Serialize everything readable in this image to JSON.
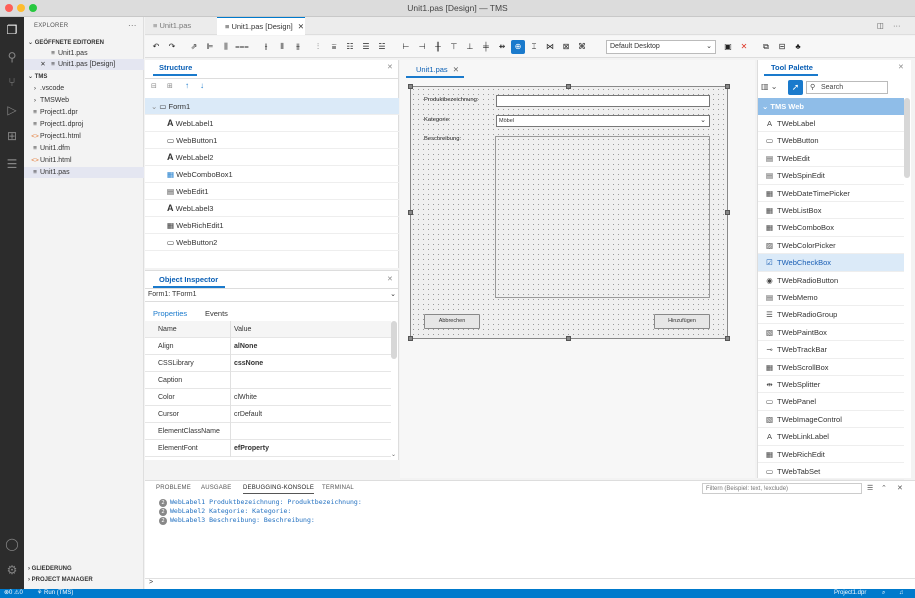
{
  "window": {
    "title": "Unit1.pas [Design] — TMS"
  },
  "explorer": {
    "header": "EXPLORER",
    "open_editors_label": "GEÖFFNETE EDITOREN",
    "open_editors": [
      {
        "name": "Unit1.pas"
      },
      {
        "name": "Unit1.pas [Design]"
      }
    ],
    "project_label": "TMS",
    "files": [
      {
        "name": ".vscode",
        "type": "folder"
      },
      {
        "name": "TMSWeb",
        "type": "folder"
      },
      {
        "name": "Project1.dpr",
        "type": "file"
      },
      {
        "name": "Project1.dproj",
        "type": "file"
      },
      {
        "name": "Project1.html",
        "type": "html"
      },
      {
        "name": "Unit1.dfm",
        "type": "file"
      },
      {
        "name": "Unit1.html",
        "type": "html"
      },
      {
        "name": "Unit1.pas",
        "type": "file"
      }
    ],
    "outline_label": "GLIEDERUNG",
    "project_manager_label": "PROJECT MANAGER"
  },
  "editor_tabs": [
    {
      "label": "Unit1.pas"
    },
    {
      "label": "Unit1.pas [Design]"
    }
  ],
  "toolbar": {
    "platform": "Default Desktop"
  },
  "structure": {
    "title": "Structure",
    "items": [
      {
        "label": "Form1",
        "icon": "form-icon"
      },
      {
        "label": "WebLabel1",
        "icon": "label-icon"
      },
      {
        "label": "WebButton1",
        "icon": "button-icon"
      },
      {
        "label": "WebLabel2",
        "icon": "label-icon"
      },
      {
        "label": "WebComboBox1",
        "icon": "combobox-icon"
      },
      {
        "label": "WebEdit1",
        "icon": "edit-icon"
      },
      {
        "label": "WebLabel3",
        "icon": "label-icon"
      },
      {
        "label": "WebRichEdit1",
        "icon": "richedit-icon"
      },
      {
        "label": "WebButton2",
        "icon": "button-icon"
      }
    ]
  },
  "inspector": {
    "title": "Object Inspector",
    "selected": "Form1: TForm1",
    "tabs": [
      "Properties",
      "Events"
    ],
    "col_name": "Name",
    "col_value": "Value",
    "rows": [
      {
        "name": "Align",
        "value": "alNone",
        "bold": true
      },
      {
        "name": "CSSLibrary",
        "value": "cssNone",
        "bold": true
      },
      {
        "name": "Caption",
        "value": "",
        "bold": false
      },
      {
        "name": "Color",
        "value": "clWhite",
        "bold": false
      },
      {
        "name": "Cursor",
        "value": "crDefault",
        "bold": false
      },
      {
        "name": "ElementClassName",
        "value": "",
        "bold": false
      },
      {
        "name": "ElementFont",
        "value": "efProperty",
        "bold": true
      }
    ]
  },
  "designer": {
    "tab": "Unit1.pas",
    "form": {
      "label1": "Produktbezeichnung:",
      "label2": "Kategorie:",
      "label3": "Beschreibung:",
      "combo_value": "Möbel",
      "button_cancel": "Abbrechen",
      "button_add": "Hinzufügen"
    }
  },
  "palette": {
    "title": "Tool Palette",
    "search_placeholder": "Search",
    "category": "TMS Web",
    "items": [
      {
        "label": "TWebLabel",
        "icon": "A"
      },
      {
        "label": "TWebButton",
        "icon": "▭"
      },
      {
        "label": "TWebEdit",
        "icon": "▤"
      },
      {
        "label": "TWebSpinEdit",
        "icon": "▤"
      },
      {
        "label": "TWebDateTimePicker",
        "icon": "▦"
      },
      {
        "label": "TWebListBox",
        "icon": "▦"
      },
      {
        "label": "TWebComboBox",
        "icon": "▦"
      },
      {
        "label": "TWebColorPicker",
        "icon": "▨"
      },
      {
        "label": "TWebCheckBox",
        "icon": "☑"
      },
      {
        "label": "TWebRadioButton",
        "icon": "◉"
      },
      {
        "label": "TWebMemo",
        "icon": "▤"
      },
      {
        "label": "TWebRadioGroup",
        "icon": "☰"
      },
      {
        "label": "TWebPaintBox",
        "icon": "▧"
      },
      {
        "label": "TWebTrackBar",
        "icon": "⊸"
      },
      {
        "label": "TWebScrollBox",
        "icon": "▦"
      },
      {
        "label": "TWebSplitter",
        "icon": "⇹"
      },
      {
        "label": "TWebPanel",
        "icon": "▭"
      },
      {
        "label": "TWebImageControl",
        "icon": "▧"
      },
      {
        "label": "TWebLinkLabel",
        "icon": "A"
      },
      {
        "label": "TWebRichEdit",
        "icon": "▦"
      },
      {
        "label": "TWebTabSet",
        "icon": "▭"
      }
    ]
  },
  "bottom_panel": {
    "tabs": [
      "PROBLEME",
      "AUSGABE",
      "DEBUGGING-KONSOLE",
      "TERMINAL"
    ],
    "filter_placeholder": "Filtern (Beispiel: text, !exclude)",
    "log": [
      {
        "count": "2",
        "text": "WebLabel1 Produktbezeichnung: Produktbezeichnung:"
      },
      {
        "count": "2",
        "text": "WebLabel2 Kategorie: Kategorie:"
      },
      {
        "count": "2",
        "text": "WebLabel3 Beschreibung: Beschreibung:"
      }
    ],
    "prompt": ">"
  },
  "statusbar": {
    "errors": "0",
    "warnings": "0",
    "run": "Run (TMS)",
    "project": "Project1.dpr"
  }
}
